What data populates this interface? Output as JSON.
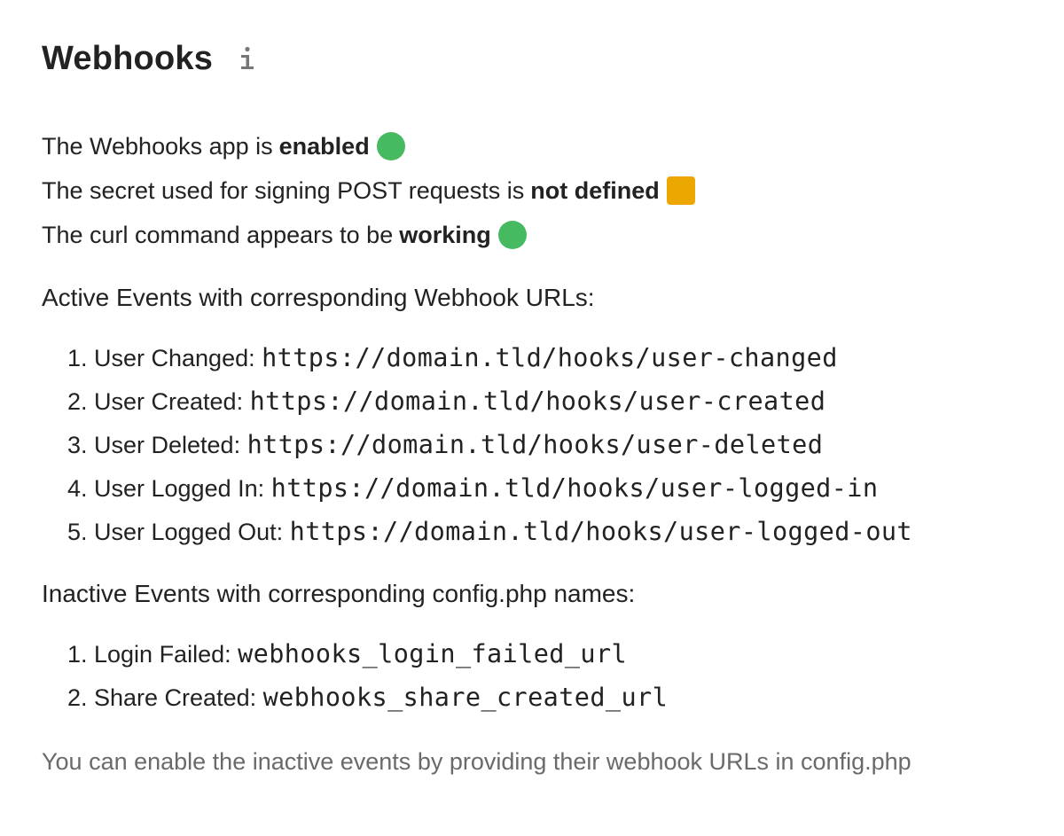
{
  "heading": {
    "title": "Webhooks",
    "info_icon": "info-icon"
  },
  "status": {
    "app": {
      "prefix": "The Webhooks app is",
      "value": "enabled",
      "indicator": "ok",
      "color": "#46ba61"
    },
    "secret": {
      "prefix": "The secret used for signing POST requests is",
      "value": "not defined",
      "indicator": "warning",
      "color": "#eca700"
    },
    "curl": {
      "prefix": "The curl command appears to be",
      "value": "working",
      "indicator": "ok",
      "color": "#46ba61"
    }
  },
  "active": {
    "title": "Active Events with corresponding Webhook URLs:",
    "items": [
      {
        "label": "User Changed:",
        "value": "https://domain.tld/hooks/user-changed"
      },
      {
        "label": "User Created:",
        "value": "https://domain.tld/hooks/user-created"
      },
      {
        "label": "User Deleted:",
        "value": "https://domain.tld/hooks/user-deleted"
      },
      {
        "label": "User Logged In:",
        "value": "https://domain.tld/hooks/user-logged-in"
      },
      {
        "label": "User Logged Out:",
        "value": "https://domain.tld/hooks/user-logged-out"
      }
    ]
  },
  "inactive": {
    "title": "Inactive Events with corresponding config.php names:",
    "items": [
      {
        "label": "Login Failed:",
        "value": "webhooks_login_failed_url"
      },
      {
        "label": "Share Created:",
        "value": "webhooks_share_created_url"
      }
    ]
  },
  "hint": "You can enable the inactive events by providing their webhook URLs in config.php"
}
